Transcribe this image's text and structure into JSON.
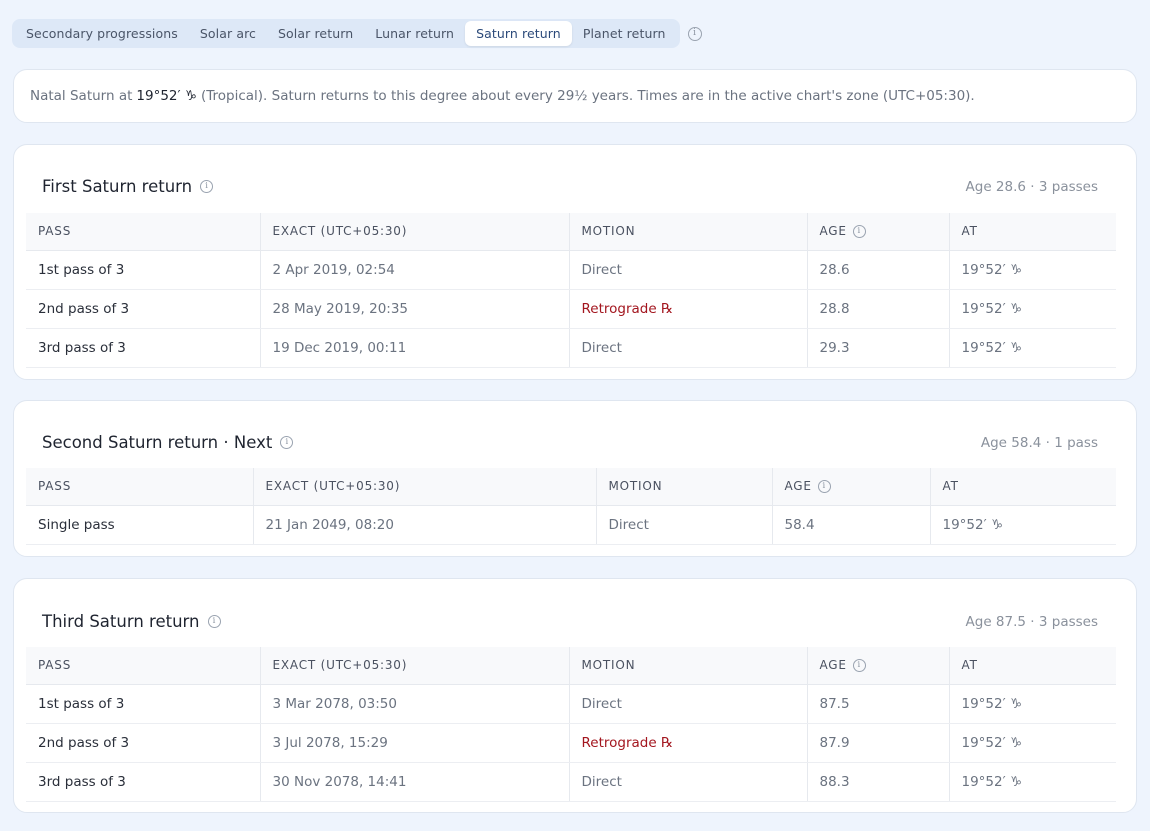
{
  "tabs": [
    {
      "label": "Secondary progressions",
      "active": false
    },
    {
      "label": "Solar arc",
      "active": false
    },
    {
      "label": "Solar return",
      "active": false
    },
    {
      "label": "Lunar return",
      "active": false
    },
    {
      "label": "Saturn return",
      "active": true
    },
    {
      "label": "Planet return",
      "active": false
    }
  ],
  "note": {
    "prefix": "Natal Saturn at",
    "position": "19°52′ ♑︎",
    "suffix": "(Tropical). Saturn returns to this degree about every 29½ years. Times are in the active chart's zone (UTC+05:30)."
  },
  "columns": {
    "pass": "PASS",
    "exact": "EXACT (UTC+05:30)",
    "motion": "MOTION",
    "age": "AGE",
    "at": "AT"
  },
  "returns": [
    {
      "title": "First Saturn return",
      "summary": "Age 28.6 · 3 passes",
      "rows": [
        {
          "pass": "1st pass of 3",
          "exact": "2 Apr 2019, 02:54",
          "motion": "Direct",
          "retro": false,
          "age": "28.6",
          "at": "19°52′ ♑︎"
        },
        {
          "pass": "2nd pass of 3",
          "exact": "28 May 2019, 20:35",
          "motion": "Retrograde ℞",
          "retro": true,
          "age": "28.8",
          "at": "19°52′ ♑︎"
        },
        {
          "pass": "3rd pass of 3",
          "exact": "19 Dec 2019, 00:11",
          "motion": "Direct",
          "retro": false,
          "age": "29.3",
          "at": "19°52′ ♑︎"
        }
      ]
    },
    {
      "title": "Second Saturn return · Next",
      "summary": "Age 58.4 · 1 pass",
      "rows": [
        {
          "pass": "Single pass",
          "exact": "21 Jan 2049, 08:20",
          "motion": "Direct",
          "retro": false,
          "age": "58.4",
          "at": "19°52′ ♑︎"
        }
      ]
    },
    {
      "title": "Third Saturn return",
      "summary": "Age 87.5 · 3 passes",
      "rows": [
        {
          "pass": "1st pass of 3",
          "exact": "3 Mar 2078, 03:50",
          "motion": "Direct",
          "retro": false,
          "age": "87.5",
          "at": "19°52′ ♑︎"
        },
        {
          "pass": "2nd pass of 3",
          "exact": "3 Jul 2078, 15:29",
          "motion": "Retrograde ℞",
          "retro": true,
          "age": "87.9",
          "at": "19°52′ ♑︎"
        },
        {
          "pass": "3rd pass of 3",
          "exact": "30 Nov 2078, 14:41",
          "motion": "Direct",
          "retro": false,
          "age": "88.3",
          "at": "19°52′ ♑︎"
        }
      ]
    }
  ]
}
